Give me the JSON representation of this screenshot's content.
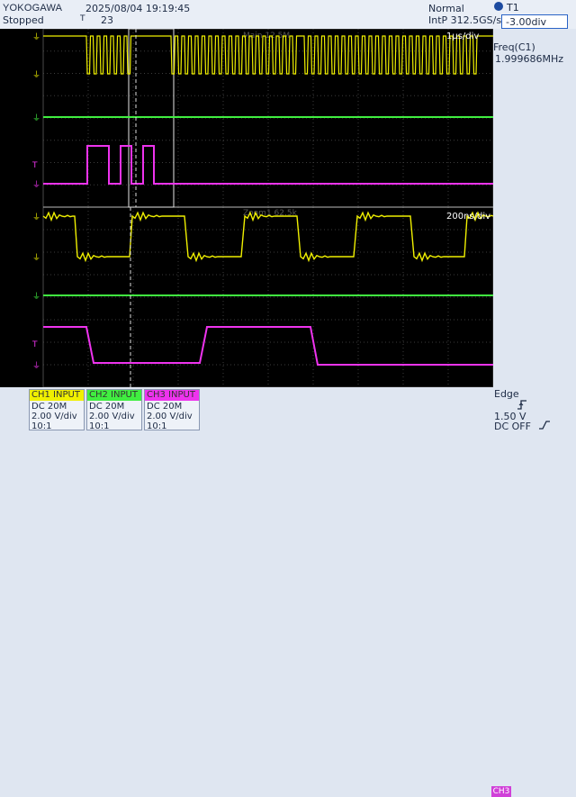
{
  "header": {
    "brand": "YOKOGAWA",
    "status": "Stopped",
    "datetime": "2025/08/04 19:19:45",
    "trig_marker": "T",
    "count": "23",
    "mode": "Normal",
    "sample_rate": "IntP  312.5GS/s",
    "t1_label": "T1",
    "t1_value": "-3.00div"
  },
  "screen": {
    "main_scale": "1µs/div",
    "zoom_scale": "200ns/div",
    "main_watermark": "Main 12.5M",
    "zoom_watermark": "Zoom1 62.5k"
  },
  "measure": {
    "label": "Freq(C1)",
    "value": "1.999686MHz"
  },
  "channels": [
    {
      "tag": "CH1 INPUT",
      "coupling": "DC 20M",
      "scale": "2.00 V/div",
      "probe": "10:1",
      "color": "#f0f000"
    },
    {
      "tag": "CH2 INPUT",
      "coupling": "DC 20M",
      "scale": "2.00 V/div",
      "probe": "10:1",
      "color": "#40ee40"
    },
    {
      "tag": "CH3 INPUT",
      "coupling": "DC 20M",
      "scale": "2.00 V/div",
      "probe": "10:1",
      "color": "#ee33ee"
    }
  ],
  "trigger": {
    "type": "Edge",
    "source": "CH3",
    "level": "1.50 V",
    "coupling": "DC OFF"
  },
  "colors": {
    "ch1": "#f0f000",
    "ch2": "#40ee40",
    "ch3": "#ee33ee",
    "grid": "#3c3c3c"
  },
  "icons": [
    "t1-cursor-icon",
    "rising-edge-icon",
    "hf-reject-icon",
    "ground-marker-icon",
    "trigger-marker-icon"
  ]
}
